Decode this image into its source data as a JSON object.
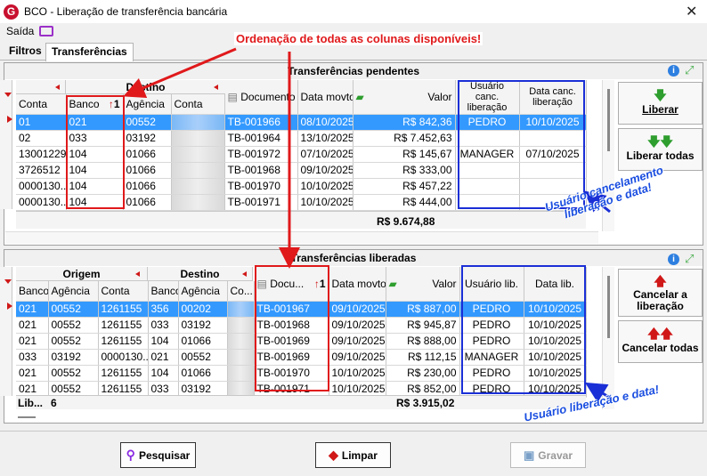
{
  "window": {
    "title": "BCO - Liberação de transferência bancária",
    "app_icon": "G"
  },
  "menu": {
    "saida": "Saída"
  },
  "tabs": [
    "Filtros",
    "Transferências"
  ],
  "pendentes": {
    "title": "Transferências pendentes",
    "group_destino": "Destino",
    "headers": [
      "Conta",
      "Banco",
      "Agência",
      "Conta",
      "Documento",
      "Data movto",
      "Valor",
      "Usuário canc. liberação",
      "Data canc. liberação"
    ],
    "sort_badge": "1",
    "rows": [
      [
        "01",
        "021",
        "00552",
        "",
        "TB-001966",
        "08/10/2025",
        "R$ 842,36",
        "PEDRO",
        "10/10/2025"
      ],
      [
        "02",
        "033",
        "03192",
        "",
        "TB-001964",
        "13/10/2025",
        "R$ 7.452,63",
        "",
        ""
      ],
      [
        "13001229",
        "104",
        "01066",
        "",
        "TB-001972",
        "07/10/2025",
        "R$ 145,67",
        "MANAGER",
        "07/10/2025"
      ],
      [
        "3726512",
        "104",
        "01066",
        "",
        "TB-001968",
        "09/10/2025",
        "R$ 333,00",
        "",
        ""
      ],
      [
        "0000130...",
        "104",
        "01066",
        "",
        "TB-001970",
        "10/10/2025",
        "R$ 457,22",
        "",
        ""
      ],
      [
        "0000130...",
        "104",
        "01066",
        "",
        "TB-001971",
        "10/10/2025",
        "R$ 444,00",
        "",
        ""
      ]
    ],
    "total": "R$ 9.674,88"
  },
  "liberadas": {
    "title": "Transferências liberadas",
    "group_origem": "Origem",
    "group_destino": "Destino",
    "headers": [
      "Banco",
      "Agência",
      "Conta",
      "Banco",
      "Agência",
      "Co...",
      "Docu...",
      "Data movto",
      "Valor",
      "Usuário lib.",
      "Data lib."
    ],
    "sort_badge": "1",
    "rows": [
      [
        "021",
        "00552",
        "1261155",
        "356",
        "00202",
        "",
        "TB-001967",
        "09/10/2025",
        "R$ 887,00",
        "PEDRO",
        "10/10/2025"
      ],
      [
        "021",
        "00552",
        "1261155",
        "033",
        "03192",
        "",
        "TB-001968",
        "09/10/2025",
        "R$ 945,87",
        "PEDRO",
        "10/10/2025"
      ],
      [
        "021",
        "00552",
        "1261155",
        "104",
        "01066",
        "",
        "TB-001969",
        "09/10/2025",
        "R$ 888,00",
        "PEDRO",
        "10/10/2025"
      ],
      [
        "033",
        "03192",
        "0000130...",
        "021",
        "00552",
        "",
        "TB-001969",
        "09/10/2025",
        "R$ 112,15",
        "MANAGER",
        "10/10/2025"
      ],
      [
        "021",
        "00552",
        "1261155",
        "104",
        "01066",
        "",
        "TB-001970",
        "10/10/2025",
        "R$ 230,00",
        "PEDRO",
        "10/10/2025"
      ],
      [
        "021",
        "00552",
        "1261155",
        "033",
        "03192",
        "",
        "TB-001971",
        "10/10/2025",
        "R$ 852,00",
        "PEDRO",
        "10/10/2025"
      ]
    ],
    "footer_label": "Lib...",
    "footer_count": "6",
    "total": "R$ 3.915,02"
  },
  "buttons": {
    "liberar": "Liberar",
    "liberar_todas": "Liberar todas",
    "cancelar": "Cancelar a liberação",
    "cancelar_todas": "Cancelar todas",
    "pesquisar": "Pesquisar",
    "limpar": "Limpar",
    "gravar": "Gravar"
  },
  "annotations": {
    "ordenacao": "Ordenação de todas as colunas disponíveis!",
    "usuario_canc": "Usuário cancelamento liberação e data!",
    "usuario_lib": "Usuário liberação e data!"
  },
  "colors": {
    "selection": "#3399ff",
    "annot_red": "#e0191b",
    "annot_blue": "#1a2fd6",
    "arrow_green": "#2e9e2e",
    "arrow_red": "#d01818"
  }
}
